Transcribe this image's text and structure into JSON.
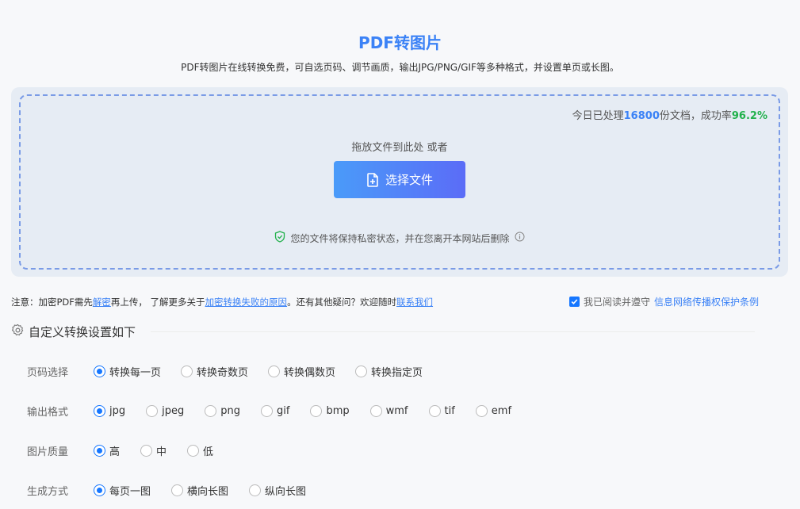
{
  "header": {
    "title": "PDF转图片",
    "subtitle": "PDF转图片在线转换免费，可自选页码、调节画质，输出JPG/PNG/GIF等多种格式，并设置单页或长图。"
  },
  "upload": {
    "stats_prefix": "今日已处理",
    "stats_count": "16800",
    "stats_mid": "份文档，成功率",
    "stats_rate": "96.2%",
    "drop_hint": "拖放文件到此处 或者",
    "choose_label": "选择文件",
    "privacy_text": "您的文件将保持私密状态，并在您离开本网站后删除"
  },
  "notice": {
    "part1": "注意：加密PDF需先",
    "link1": "解密",
    "part2": "再上传，  了解更多关于",
    "link2": "加密转换失败的原因",
    "part3": "。还有其他疑问？欢迎随时",
    "link3": "联系我们"
  },
  "agreement": {
    "prefix": "我已阅读并遵守",
    "link": "信息网络传播权保护条例"
  },
  "settings": {
    "heading": "自定义转换设置如下",
    "page_select": {
      "label": "页码选择",
      "options": [
        "转换每一页",
        "转换奇数页",
        "转换偶数页",
        "转换指定页"
      ]
    },
    "output_format": {
      "label": "输出格式",
      "options": [
        "jpg",
        "jpeg",
        "png",
        "gif",
        "bmp",
        "wmf",
        "tif",
        "emf"
      ]
    },
    "quality": {
      "label": "图片质量",
      "options": [
        "高",
        "中",
        "低"
      ]
    },
    "mode": {
      "label": "生成方式",
      "options": [
        "每页一图",
        "横向长图",
        "纵向长图"
      ]
    }
  },
  "colors": {
    "accent": "#3b82f6",
    "success": "#22b14c",
    "radio_active": "#1677ff"
  }
}
